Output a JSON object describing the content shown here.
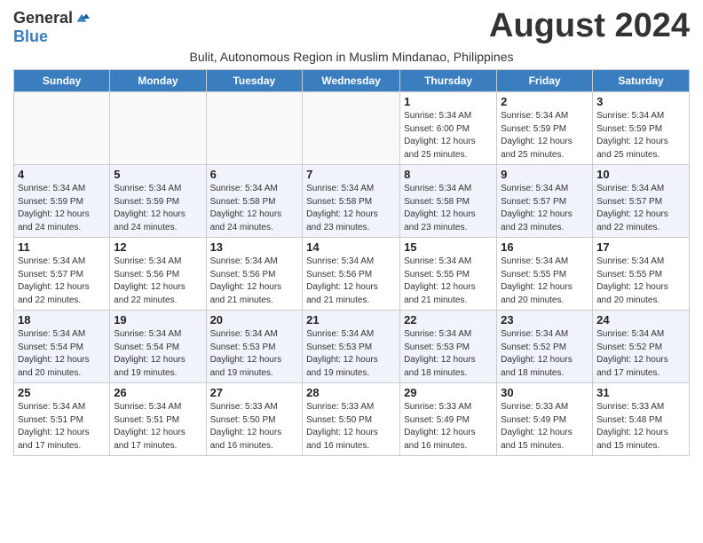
{
  "header": {
    "logo_general": "General",
    "logo_blue": "Blue",
    "month_title": "August 2024",
    "subtitle": "Bulit, Autonomous Region in Muslim Mindanao, Philippines"
  },
  "days_of_week": [
    "Sunday",
    "Monday",
    "Tuesday",
    "Wednesday",
    "Thursday",
    "Friday",
    "Saturday"
  ],
  "weeks": [
    [
      {
        "day": "",
        "detail": ""
      },
      {
        "day": "",
        "detail": ""
      },
      {
        "day": "",
        "detail": ""
      },
      {
        "day": "",
        "detail": ""
      },
      {
        "day": "1",
        "detail": "Sunrise: 5:34 AM\nSunset: 6:00 PM\nDaylight: 12 hours\nand 25 minutes."
      },
      {
        "day": "2",
        "detail": "Sunrise: 5:34 AM\nSunset: 5:59 PM\nDaylight: 12 hours\nand 25 minutes."
      },
      {
        "day": "3",
        "detail": "Sunrise: 5:34 AM\nSunset: 5:59 PM\nDaylight: 12 hours\nand 25 minutes."
      }
    ],
    [
      {
        "day": "4",
        "detail": "Sunrise: 5:34 AM\nSunset: 5:59 PM\nDaylight: 12 hours\nand 24 minutes."
      },
      {
        "day": "5",
        "detail": "Sunrise: 5:34 AM\nSunset: 5:59 PM\nDaylight: 12 hours\nand 24 minutes."
      },
      {
        "day": "6",
        "detail": "Sunrise: 5:34 AM\nSunset: 5:58 PM\nDaylight: 12 hours\nand 24 minutes."
      },
      {
        "day": "7",
        "detail": "Sunrise: 5:34 AM\nSunset: 5:58 PM\nDaylight: 12 hours\nand 23 minutes."
      },
      {
        "day": "8",
        "detail": "Sunrise: 5:34 AM\nSunset: 5:58 PM\nDaylight: 12 hours\nand 23 minutes."
      },
      {
        "day": "9",
        "detail": "Sunrise: 5:34 AM\nSunset: 5:57 PM\nDaylight: 12 hours\nand 23 minutes."
      },
      {
        "day": "10",
        "detail": "Sunrise: 5:34 AM\nSunset: 5:57 PM\nDaylight: 12 hours\nand 22 minutes."
      }
    ],
    [
      {
        "day": "11",
        "detail": "Sunrise: 5:34 AM\nSunset: 5:57 PM\nDaylight: 12 hours\nand 22 minutes."
      },
      {
        "day": "12",
        "detail": "Sunrise: 5:34 AM\nSunset: 5:56 PM\nDaylight: 12 hours\nand 22 minutes."
      },
      {
        "day": "13",
        "detail": "Sunrise: 5:34 AM\nSunset: 5:56 PM\nDaylight: 12 hours\nand 21 minutes."
      },
      {
        "day": "14",
        "detail": "Sunrise: 5:34 AM\nSunset: 5:56 PM\nDaylight: 12 hours\nand 21 minutes."
      },
      {
        "day": "15",
        "detail": "Sunrise: 5:34 AM\nSunset: 5:55 PM\nDaylight: 12 hours\nand 21 minutes."
      },
      {
        "day": "16",
        "detail": "Sunrise: 5:34 AM\nSunset: 5:55 PM\nDaylight: 12 hours\nand 20 minutes."
      },
      {
        "day": "17",
        "detail": "Sunrise: 5:34 AM\nSunset: 5:55 PM\nDaylight: 12 hours\nand 20 minutes."
      }
    ],
    [
      {
        "day": "18",
        "detail": "Sunrise: 5:34 AM\nSunset: 5:54 PM\nDaylight: 12 hours\nand 20 minutes."
      },
      {
        "day": "19",
        "detail": "Sunrise: 5:34 AM\nSunset: 5:54 PM\nDaylight: 12 hours\nand 19 minutes."
      },
      {
        "day": "20",
        "detail": "Sunrise: 5:34 AM\nSunset: 5:53 PM\nDaylight: 12 hours\nand 19 minutes."
      },
      {
        "day": "21",
        "detail": "Sunrise: 5:34 AM\nSunset: 5:53 PM\nDaylight: 12 hours\nand 19 minutes."
      },
      {
        "day": "22",
        "detail": "Sunrise: 5:34 AM\nSunset: 5:53 PM\nDaylight: 12 hours\nand 18 minutes."
      },
      {
        "day": "23",
        "detail": "Sunrise: 5:34 AM\nSunset: 5:52 PM\nDaylight: 12 hours\nand 18 minutes."
      },
      {
        "day": "24",
        "detail": "Sunrise: 5:34 AM\nSunset: 5:52 PM\nDaylight: 12 hours\nand 17 minutes."
      }
    ],
    [
      {
        "day": "25",
        "detail": "Sunrise: 5:34 AM\nSunset: 5:51 PM\nDaylight: 12 hours\nand 17 minutes."
      },
      {
        "day": "26",
        "detail": "Sunrise: 5:34 AM\nSunset: 5:51 PM\nDaylight: 12 hours\nand 17 minutes."
      },
      {
        "day": "27",
        "detail": "Sunrise: 5:33 AM\nSunset: 5:50 PM\nDaylight: 12 hours\nand 16 minutes."
      },
      {
        "day": "28",
        "detail": "Sunrise: 5:33 AM\nSunset: 5:50 PM\nDaylight: 12 hours\nand 16 minutes."
      },
      {
        "day": "29",
        "detail": "Sunrise: 5:33 AM\nSunset: 5:49 PM\nDaylight: 12 hours\nand 16 minutes."
      },
      {
        "day": "30",
        "detail": "Sunrise: 5:33 AM\nSunset: 5:49 PM\nDaylight: 12 hours\nand 15 minutes."
      },
      {
        "day": "31",
        "detail": "Sunrise: 5:33 AM\nSunset: 5:48 PM\nDaylight: 12 hours\nand 15 minutes."
      }
    ]
  ]
}
